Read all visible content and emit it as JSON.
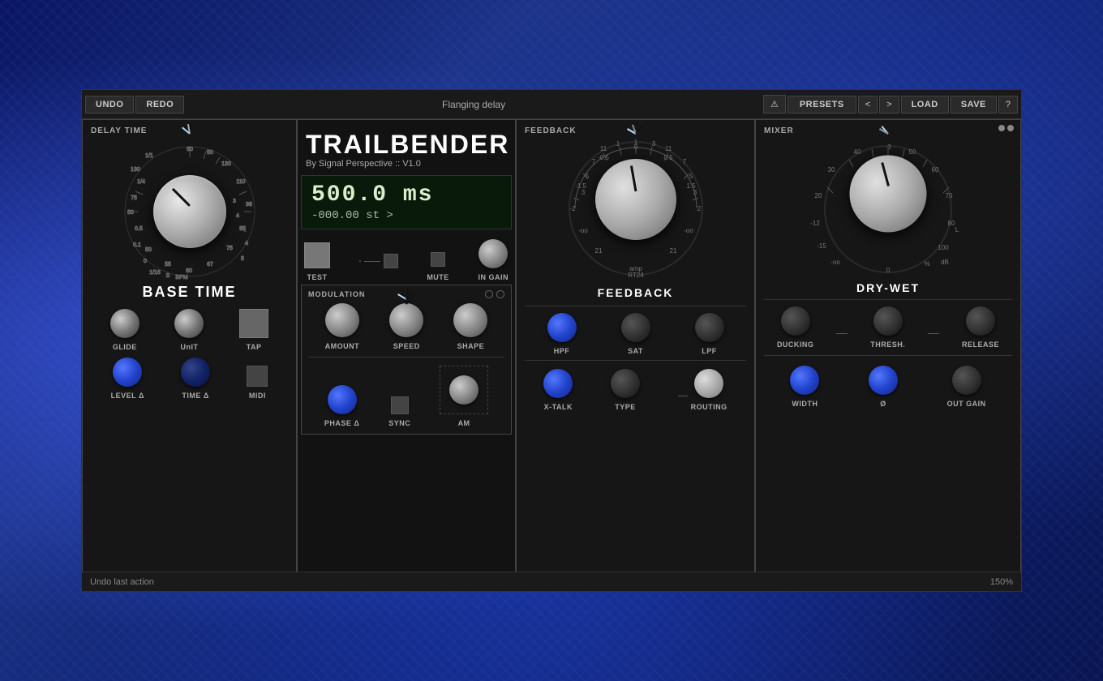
{
  "toolbar": {
    "undo_label": "UNDO",
    "redo_label": "REDO",
    "preset_name": "Flanging delay",
    "warning_icon": "⚠",
    "presets_label": "PRESETS",
    "prev_label": "<",
    "next_label": ">",
    "load_label": "LOAD",
    "save_label": "SAVE",
    "help_label": "?"
  },
  "plugin": {
    "title": "TRAILBENDER",
    "subtitle": "By Signal Perspective :: V1.0",
    "display_main": "500.0 ms",
    "display_sub": "-000.00 st >"
  },
  "delay_panel": {
    "label": "DELAY TIME",
    "section_title": "BASE TIME",
    "knobs": {
      "glide_label": "GLIDE",
      "unit_label": "UnIT",
      "tap_label": "TAP",
      "level_label": "LEVEL Δ",
      "time_label": "TIME Δ",
      "midi_label": "MIDI"
    },
    "buttons": {
      "test_label": "TEST",
      "midi_label": "MIDI",
      "mute_label": "MUTE",
      "in_gain_label": "IN GAIN"
    }
  },
  "modulation": {
    "label": "MODULATION",
    "knobs": {
      "amount_label": "AMOUNT",
      "speed_label": "SPEED",
      "shape_label": "SHAPE",
      "phase_label": "PHASE Δ",
      "sync_label": "SYNC",
      "am_label": "AM"
    }
  },
  "feedback_panel": {
    "label": "FEEDBACK",
    "section_title": "FEEDBACK",
    "knobs": {
      "hpf_label": "HPF",
      "sat_label": "SAT",
      "lpf_label": "LPF",
      "xtalk_label": "X-TALK",
      "type_label": "TYPE",
      "routing_label": "ROUTING"
    },
    "dial_markers": {
      "neg2": "-2",
      "neg15": "-1.5",
      "neg05": "-0.5",
      "zero": "0",
      "pos05": "0.5",
      "pos15": "1.5",
      "pos2": "2",
      "amp": "amp",
      "rt24": "RT24"
    }
  },
  "mixer_panel": {
    "label": "MIXER",
    "section_title": "DRY-WET",
    "knobs": {
      "ducking_label": "DUCKING",
      "thresh_label": "THRESH.",
      "release_label": "RELEASE",
      "width_label": "WIDTH",
      "phase_label": "Ø",
      "out_gain_label": "OUT GAIN"
    }
  },
  "status_bar": {
    "message": "Undo last action",
    "zoom": "150%"
  }
}
